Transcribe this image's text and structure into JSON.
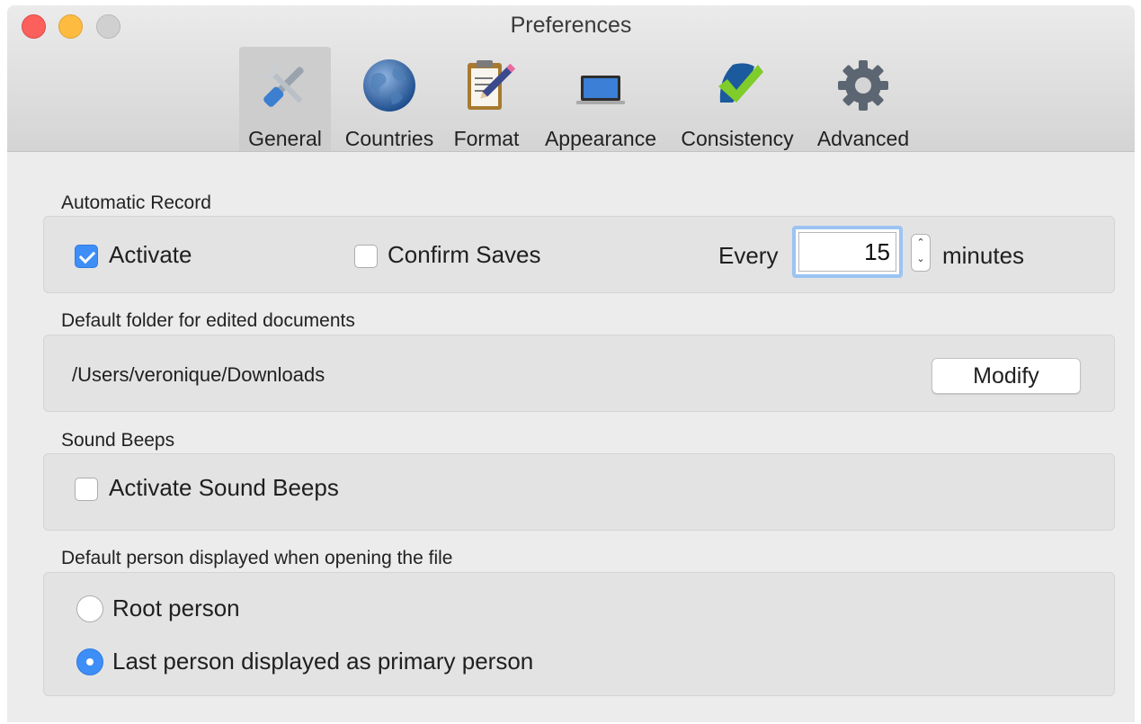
{
  "window": {
    "title": "Preferences"
  },
  "toolbar": {
    "tabs": [
      {
        "label": "General",
        "icon": "tools-icon",
        "selected": true
      },
      {
        "label": "Countries",
        "icon": "globe-icon",
        "selected": false
      },
      {
        "label": "Format",
        "icon": "clipboard-pencil-icon",
        "selected": false
      },
      {
        "label": "Appearance",
        "icon": "laptop-icon",
        "selected": false
      },
      {
        "label": "Consistency",
        "icon": "checkmark-icon",
        "selected": false
      },
      {
        "label": "Advanced",
        "icon": "gear-icon",
        "selected": false
      }
    ]
  },
  "automatic_record": {
    "title": "Automatic Record",
    "activate_label": "Activate",
    "activate_checked": true,
    "confirm_label": "Confirm Saves",
    "confirm_checked": false,
    "every_label": "Every",
    "interval_value": "15",
    "minutes_label": "minutes"
  },
  "default_folder": {
    "title": "Default folder for edited documents",
    "path": "/Users/veronique/Downloads",
    "modify_label": "Modify"
  },
  "sound_beeps": {
    "title": "Sound Beeps",
    "activate_label": "Activate Sound Beeps",
    "checked": false
  },
  "default_person": {
    "title": "Default person displayed when opening the file",
    "options": [
      {
        "label": "Root person",
        "selected": false
      },
      {
        "label": "Last person displayed as primary person",
        "selected": true
      }
    ]
  },
  "colors": {
    "accent": "#3d8ef7",
    "window_bg": "#ececec",
    "group_bg": "#e3e3e3"
  }
}
